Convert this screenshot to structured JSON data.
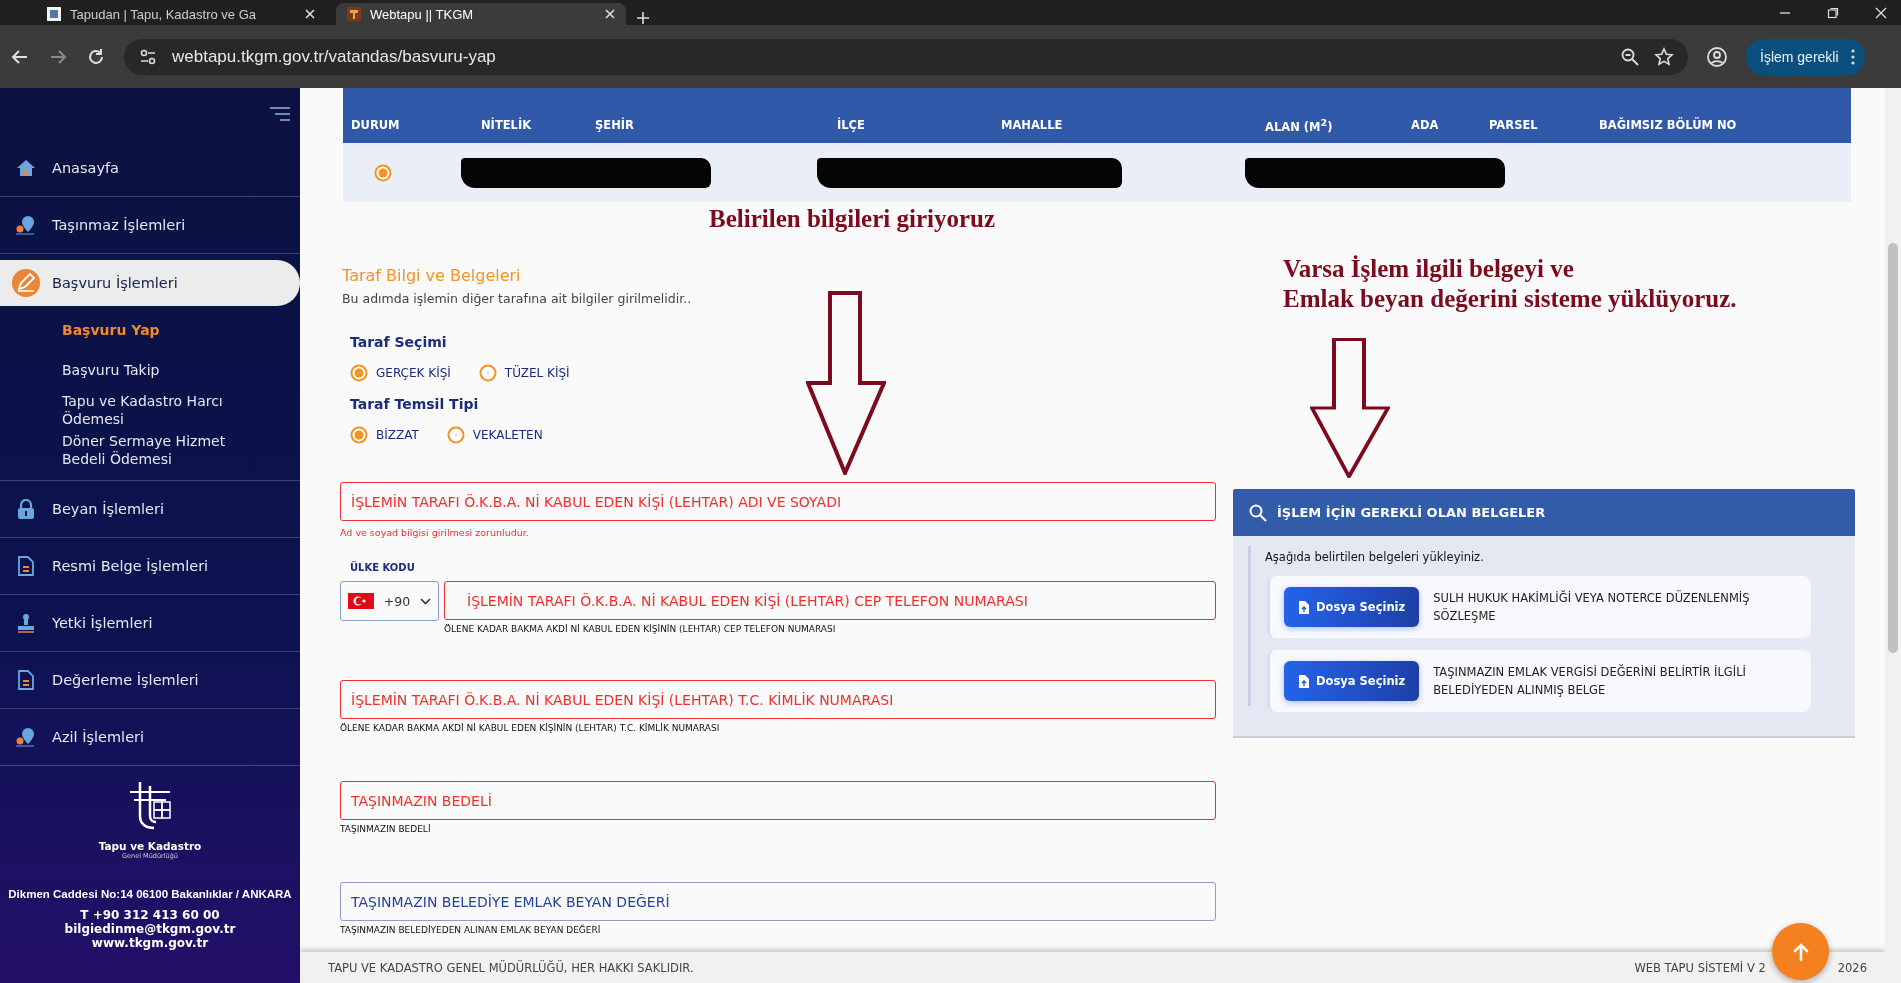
{
  "browser": {
    "tabs": [
      {
        "title": "Tapudan | Tapu, Kadastro ve Ga",
        "selected": false
      },
      {
        "title": "Webtapu || TKGM",
        "selected": true
      }
    ],
    "url": "webtapu.tkgm.gov.tr/vatandas/basvuru-yap",
    "profile_button": "İşlem gerekli"
  },
  "sidebar": {
    "items": [
      {
        "label": "Anasayfa",
        "selected": false
      },
      {
        "label": "Taşınmaz İşlemleri",
        "selected": false
      },
      {
        "label": "Başvuru İşlemleri",
        "selected": true,
        "children": [
          {
            "label": "Başvuru Yap",
            "selected": true
          },
          {
            "label": "Başvuru Takip",
            "selected": false
          },
          {
            "label": "Tapu ve Kadastro Harcı Ödemesi",
            "selected": false
          },
          {
            "label": "Döner Sermaye Hizmet Bedeli Ödemesi",
            "selected": false
          }
        ]
      },
      {
        "label": "Beyan İşlemleri",
        "selected": false
      },
      {
        "label": "Resmi Belge İşlemleri",
        "selected": false
      },
      {
        "label": "Yetki İşlemleri",
        "selected": false
      },
      {
        "label": "Değerleme İşlemleri",
        "selected": false
      },
      {
        "label": "Azil İşlemleri",
        "selected": false
      }
    ],
    "footer": {
      "org": "Tapu ve Kadastro",
      "org_sub": "Genel Müdürlüğü",
      "address": "Dikmen Caddesi No:14 06100 Bakanlıklar / ANKARA",
      "phone": "T +90 312 413 60 00",
      "email": "bilgiedinme@tkgm.gov.tr",
      "web": "www.tkgm.gov.tr"
    }
  },
  "table": {
    "columns": [
      "DURUM",
      "NİTELİK",
      "ŞEHİR",
      "İLÇE",
      "MAHALLE",
      "ALAN (M$^{2}$)",
      "ADA",
      "PARSEL",
      "BAĞIMSIZ BÖLÜM NO"
    ],
    "rows": [
      {
        "selected": true,
        "redacted": true
      }
    ]
  },
  "form": {
    "title": "Taraf Bilgi ve Belgeleri",
    "subtitle": "Bu adımda işlemin diğer tarafına ait bilgiler girilmelidir..",
    "radio_groups": [
      {
        "label": "Taraf Seçimi",
        "options": [
          {
            "label": "GERÇEK KİŞİ",
            "selected": true
          },
          {
            "label": "TÜZEL KİŞİ",
            "selected": false
          }
        ]
      },
      {
        "label": "Taraf Temsil Tipi",
        "options": [
          {
            "label": "BİZZAT",
            "selected": true
          },
          {
            "label": "VEKALETEN",
            "selected": false
          }
        ]
      }
    ],
    "fields": [
      {
        "kind": "text",
        "placeholder": "İŞLEMİN TARAFI Ö.K.B.A. Nİ KABUL EDEN KİŞİ (LEHTAR) ADI VE SOYADI",
        "invalid": true,
        "error": "Ad ve soyad bilgisi girilmesi zorunludur."
      },
      {
        "kind": "phone",
        "country_label": "ÜLKE KODU",
        "country_code": "+90",
        "placeholder": "İŞLEMİN TARAFI Ö.K.B.A. Nİ KABUL EDEN KİŞİ (LEHTAR) CEP TELEFON NUMARASI",
        "invalid": true,
        "hint": "ÖLENE KADAR BAKMA AKDİ Nİ KABUL EDEN KİŞİNİN (LEHTAR) CEP TELEFON NUMARASI"
      },
      {
        "kind": "text",
        "placeholder": "İŞLEMİN TARAFI Ö.K.B.A. Nİ KABUL EDEN KİŞİ (LEHTAR) T.C. KİMLİK NUMARASI",
        "invalid": true,
        "hint": "ÖLENE KADAR BAKMA AKDİ Nİ KABUL EDEN KİŞİNİN (LEHTAR) T.C. KİMLİK NUMARASI"
      },
      {
        "kind": "text",
        "placeholder": "TAŞINMAZIN BEDELİ",
        "invalid": true,
        "hint": "TAŞINMAZIN BEDELİ"
      },
      {
        "kind": "text",
        "placeholder": "TAŞINMAZIN BELEDİYE EMLAK BEYAN DEĞERİ",
        "invalid": false,
        "hint": "TAŞINMAZIN BELEDİYEDEN ALINAN EMLAK BEYAN DEĞERİ"
      }
    ]
  },
  "documents_panel": {
    "title": "İŞLEM İÇİN GEREKLİ OLAN BELGELER",
    "intro": "Aşağıda belirtilen belgeleri yükleyiniz.",
    "documents": [
      {
        "button": "Dosya Seçiniz",
        "label": "SULH HUKUK HAKİMLİĞİ VEYA NOTERCE DÜZENLENMİŞ SÖZLEŞME"
      },
      {
        "button": "Dosya Seçiniz",
        "label": "TAŞINMAZIN EMLAK VERGİSİ DEĞERİNİ BELİRTİR İLGİLİ BELEDİYEDEN ALINMIŞ BELGE"
      }
    ]
  },
  "annotations": [
    {
      "lines": [
        "Belirilen bilgileri giriyoruz"
      ]
    },
    {
      "lines": [
        "Varsa İşlem ilgili belgeyi ve",
        "Emlak beyan değerini sisteme yüklüyoruz."
      ]
    }
  ],
  "page_footer": {
    "copyright": "TAPU VE KADASTRO GENEL MÜDÜRLÜĞÜ, HER HAKKI SAKLIDIR.",
    "version_parts": [
      "WEB TAPU SİSTEMİ V 2",
      "2026"
    ]
  }
}
